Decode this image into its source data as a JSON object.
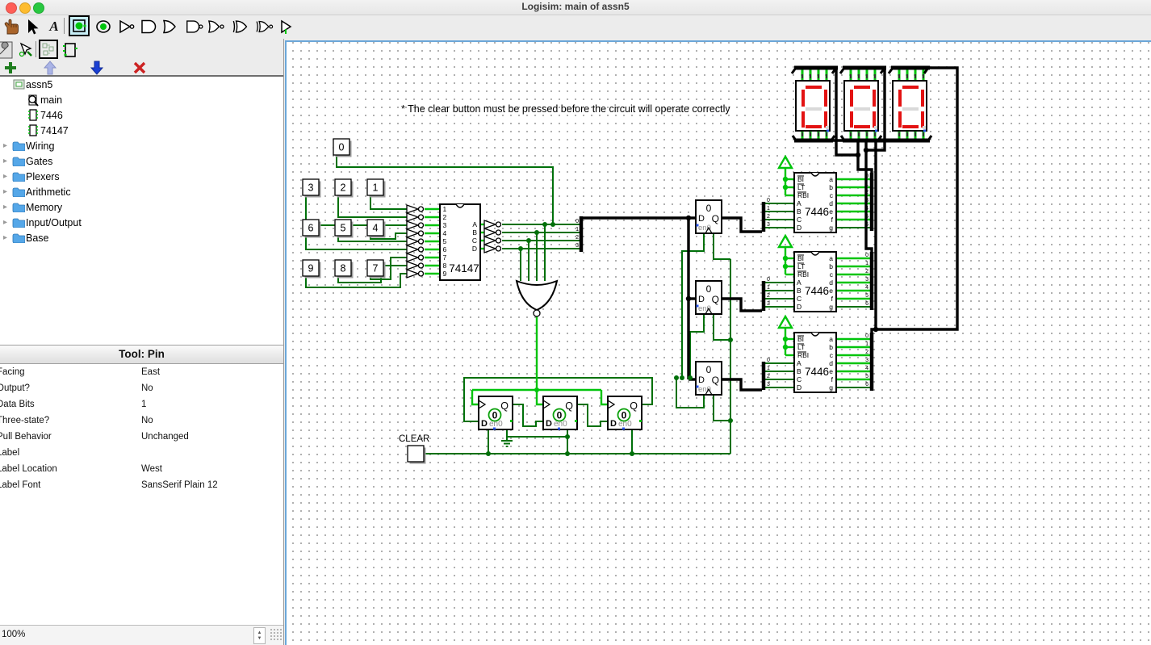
{
  "window": {
    "title": "Logisim: main of assn5"
  },
  "toolbar": {
    "text_tool_label": "A"
  },
  "explorer": {
    "root": "assn5",
    "circuits": [
      "main",
      "7446",
      "74147"
    ],
    "libraries": [
      "Wiring",
      "Gates",
      "Plexers",
      "Arithmetic",
      "Memory",
      "Input/Output",
      "Base"
    ]
  },
  "attributes": {
    "title": "Tool: Pin",
    "rows": [
      [
        "Facing",
        "East"
      ],
      [
        "Output?",
        "No"
      ],
      [
        "Data Bits",
        "1"
      ],
      [
        "Three-state?",
        "No"
      ],
      [
        "Pull Behavior",
        "Unchanged"
      ],
      [
        "Label",
        ""
      ],
      [
        "Label Location",
        "West"
      ],
      [
        "Label Font",
        "SansSerif Plain 12"
      ]
    ]
  },
  "statusbar": {
    "zoom": "100%"
  },
  "canvas": {
    "note": "* The clear button must be pressed before the circuit will operate correctly",
    "clear_label": "CLEAR",
    "buttons": {
      "b0": "0",
      "b1": "1",
      "b2": "2",
      "b3": "3",
      "b4": "4",
      "b5": "5",
      "b6": "6",
      "b7": "7",
      "b8": "8",
      "b9": "9"
    },
    "ic74147": {
      "name": "74147",
      "inputs": [
        "1",
        "2",
        "3",
        "4",
        "5",
        "6",
        "7",
        "8",
        "9"
      ],
      "outputs": [
        "A",
        "B",
        "C",
        "D"
      ]
    },
    "ic7446": {
      "name": "7446",
      "control": [
        "BI",
        "LT",
        "RBI"
      ],
      "inputs": [
        "A",
        "B",
        "C",
        "D"
      ],
      "outputs": [
        "a",
        "b",
        "c",
        "d",
        "e",
        "f",
        "g"
      ]
    },
    "register": {
      "value": "0",
      "d": "D",
      "q": "Q",
      "en": "en0"
    },
    "flipflop": {
      "value": "0",
      "d": "D",
      "q": "Q",
      "en": "en0"
    },
    "display": {
      "value": "0"
    },
    "bits4": [
      "0",
      "1",
      "2",
      "3"
    ],
    "bits7": [
      "0",
      "1",
      "2",
      "3",
      "4",
      "5",
      "6"
    ]
  },
  "colors": {
    "wire_off": "#00700a",
    "wire_on": "#00c40c",
    "bus": "#000000",
    "segment_on": "#e31212",
    "accent_selection": "#c8eef6"
  }
}
